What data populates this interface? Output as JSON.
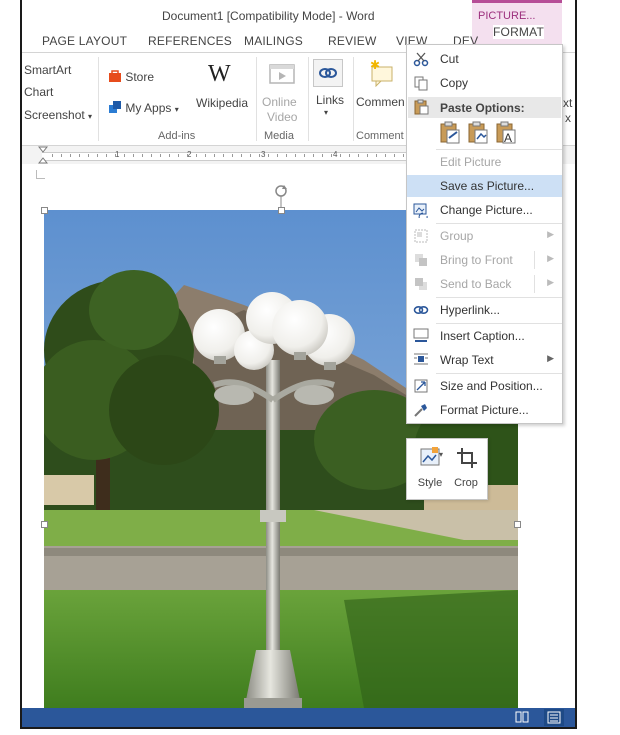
{
  "window": {
    "title": "Document1 [Compatibility Mode] - Word"
  },
  "context_tab": {
    "group_label": "PICTURE...",
    "tab_label": "FORMAT"
  },
  "tabs": [
    "PAGE LAYOUT",
    "REFERENCES",
    "MAILINGS",
    "REVIEW",
    "VIEW",
    "DEV"
  ],
  "ribbon": {
    "illustrations": {
      "smartart": "SmartArt",
      "chart": "Chart",
      "screenshot": "Screenshot"
    },
    "addins": {
      "store": "Store",
      "myapps": "My Apps",
      "wikipedia": "Wikipedia",
      "group_label": "Add-ins"
    },
    "media": {
      "online_video_line1": "Online",
      "online_video_line2": "Video",
      "group_label": "Media"
    },
    "links": {
      "label": "Links"
    },
    "comments": {
      "label": "Commen",
      "group_label": "Comment"
    },
    "text": {
      "partial1": "xt",
      "partial2": "x"
    }
  },
  "ruler": {
    "numbers": [
      "1",
      "2",
      "3",
      "4"
    ]
  },
  "context_menu": {
    "cut": "Cut",
    "copy": "Copy",
    "paste_options": "Paste Options:",
    "edit_picture": "Edit Picture",
    "save_as_picture": "Save as Picture...",
    "change_picture": "Change Picture...",
    "group": "Group",
    "bring_to_front": "Bring to Front",
    "send_to_back": "Send to Back",
    "hyperlink": "Hyperlink...",
    "insert_caption": "Insert Caption...",
    "wrap_text": "Wrap Text",
    "size_position": "Size and Position...",
    "format_picture": "Format Picture..."
  },
  "mini_toolbar": {
    "style": "Style",
    "crop": "Crop"
  },
  "colors": {
    "accent_blue": "#2b579a",
    "picture_tools": "#b64e97",
    "highlight": "#cde0f5"
  }
}
